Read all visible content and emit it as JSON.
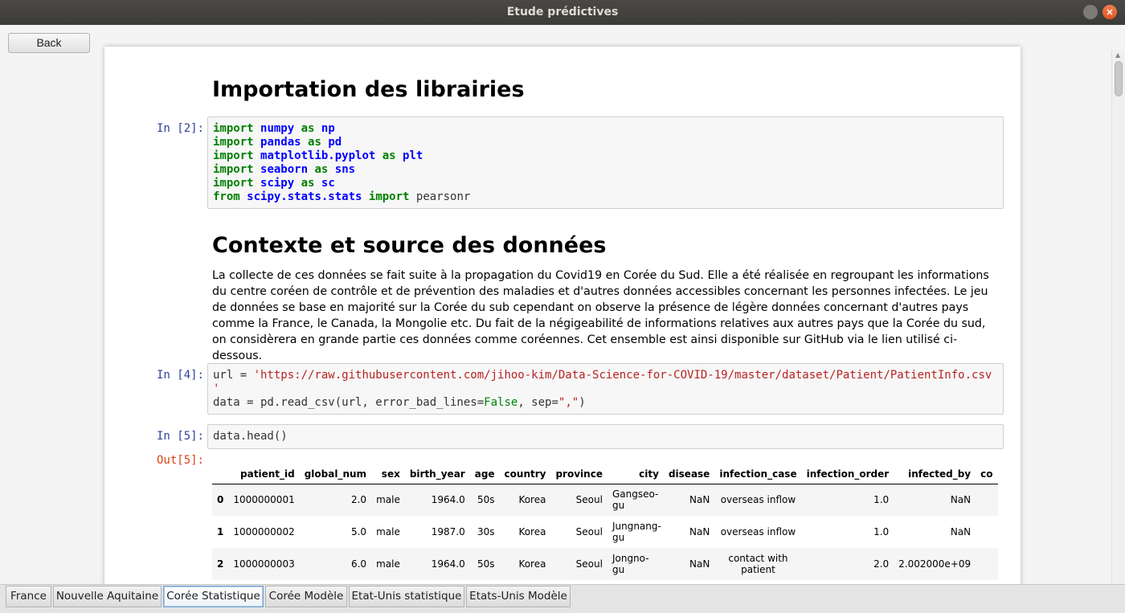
{
  "window": {
    "title": "Etude prédictives"
  },
  "back_button": "Back",
  "notebook": {
    "heading1": "Importation des librairies",
    "cell1": {
      "prompt": "In [2]:",
      "lines": [
        [
          {
            "t": "import",
            "c": "kw"
          },
          {
            "t": " "
          },
          {
            "t": "numpy",
            "c": "nn"
          },
          {
            "t": " "
          },
          {
            "t": "as",
            "c": "kw"
          },
          {
            "t": " "
          },
          {
            "t": "np",
            "c": "nn"
          }
        ],
        [
          {
            "t": "import",
            "c": "kw"
          },
          {
            "t": " "
          },
          {
            "t": "pandas",
            "c": "nn"
          },
          {
            "t": " "
          },
          {
            "t": "as",
            "c": "kw"
          },
          {
            "t": " "
          },
          {
            "t": "pd",
            "c": "nn"
          }
        ],
        [
          {
            "t": "import",
            "c": "kw"
          },
          {
            "t": " "
          },
          {
            "t": "matplotlib.pyplot",
            "c": "nn"
          },
          {
            "t": " "
          },
          {
            "t": "as",
            "c": "kw"
          },
          {
            "t": " "
          },
          {
            "t": "plt",
            "c": "nn"
          }
        ],
        [
          {
            "t": "import",
            "c": "kw"
          },
          {
            "t": " "
          },
          {
            "t": "seaborn",
            "c": "nn"
          },
          {
            "t": " "
          },
          {
            "t": "as",
            "c": "kw"
          },
          {
            "t": " "
          },
          {
            "t": "sns",
            "c": "nn"
          }
        ],
        [
          {
            "t": "import",
            "c": "kw"
          },
          {
            "t": " "
          },
          {
            "t": "scipy",
            "c": "nn"
          },
          {
            "t": " "
          },
          {
            "t": "as",
            "c": "kw"
          },
          {
            "t": " "
          },
          {
            "t": "sc",
            "c": "nn"
          }
        ],
        [
          {
            "t": "from",
            "c": "kw"
          },
          {
            "t": " "
          },
          {
            "t": "scipy.stats.stats",
            "c": "nn"
          },
          {
            "t": " "
          },
          {
            "t": "import",
            "c": "kw"
          },
          {
            "t": " pearsonr"
          }
        ]
      ]
    },
    "heading2": "Contexte et source des données",
    "paragraph": "La collecte de ces données se fait suite à la propagation du Covid19 en Corée du Sud. Elle a été réalisée en regroupant les informations du centre coréen de contrôle et de prévention des maladies et d'autres données accessibles concernant les personnes infectées. Le jeu de données se base en majorité sur la Corée du sub cependant on observe la présence de légère données concernant d'autres pays comme la France, le Canada, la Mongolie etc. Du fait de la négigeabilité de informations relatives aux autres pays que la Corée du sud, on considèrera en grande partie ces données comme coréennes. Cet ensemble est ainsi disponible sur GitHub via le lien utilisé ci-dessous.",
    "cell2": {
      "prompt": "In [4]:",
      "lines": [
        [
          {
            "t": "url = "
          },
          {
            "t": "'https://raw.githubusercontent.com/jihoo-kim/Data-Science-for-COVID-19/master/dataset/Patient/PatientInfo.csv",
            "c": "str"
          }
        ],
        [
          {
            "t": "'",
            "c": "str"
          }
        ],
        [
          {
            "t": "data = pd.read_csv(url, error_bad_lines="
          },
          {
            "t": "False",
            "c": "kc"
          },
          {
            "t": ", sep="
          },
          {
            "t": "\",\"",
            "c": "str"
          },
          {
            "t": ")"
          }
        ]
      ]
    },
    "cell3": {
      "prompt": "In [5]:",
      "lines": [
        [
          {
            "t": "data.head()"
          }
        ]
      ]
    },
    "output": {
      "prompt": "Out[5]:",
      "columns": [
        "",
        "patient_id",
        "global_num",
        "sex",
        "birth_year",
        "age",
        "country",
        "province",
        "city",
        "disease",
        "infection_case",
        "infection_order",
        "infected_by",
        "co"
      ],
      "rows": [
        [
          "0",
          "1000000001",
          "2.0",
          "male",
          "1964.0",
          "50s",
          "Korea",
          "Seoul",
          "Gangseo-gu",
          "NaN",
          "overseas inflow",
          "1.0",
          "NaN",
          ""
        ],
        [
          "1",
          "1000000002",
          "5.0",
          "male",
          "1987.0",
          "30s",
          "Korea",
          "Seoul",
          "Jungnang-gu",
          "NaN",
          "overseas inflow",
          "1.0",
          "NaN",
          ""
        ],
        [
          "2",
          "1000000003",
          "6.0",
          "male",
          "1964.0",
          "50s",
          "Korea",
          "Seoul",
          "Jongno-gu",
          "NaN",
          "contact with patient",
          "2.0",
          "2.002000e+09",
          ""
        ]
      ]
    }
  },
  "tabs": [
    {
      "label": "France",
      "active": false
    },
    {
      "label": "Nouvelle Aquitaine",
      "active": false
    },
    {
      "label": "Corée Statistique",
      "active": true
    },
    {
      "label": "Corée Modèle",
      "active": false
    },
    {
      "label": "Etat-Unis statistique",
      "active": false
    },
    {
      "label": "Etats-Unis Modèle",
      "active": false
    }
  ]
}
